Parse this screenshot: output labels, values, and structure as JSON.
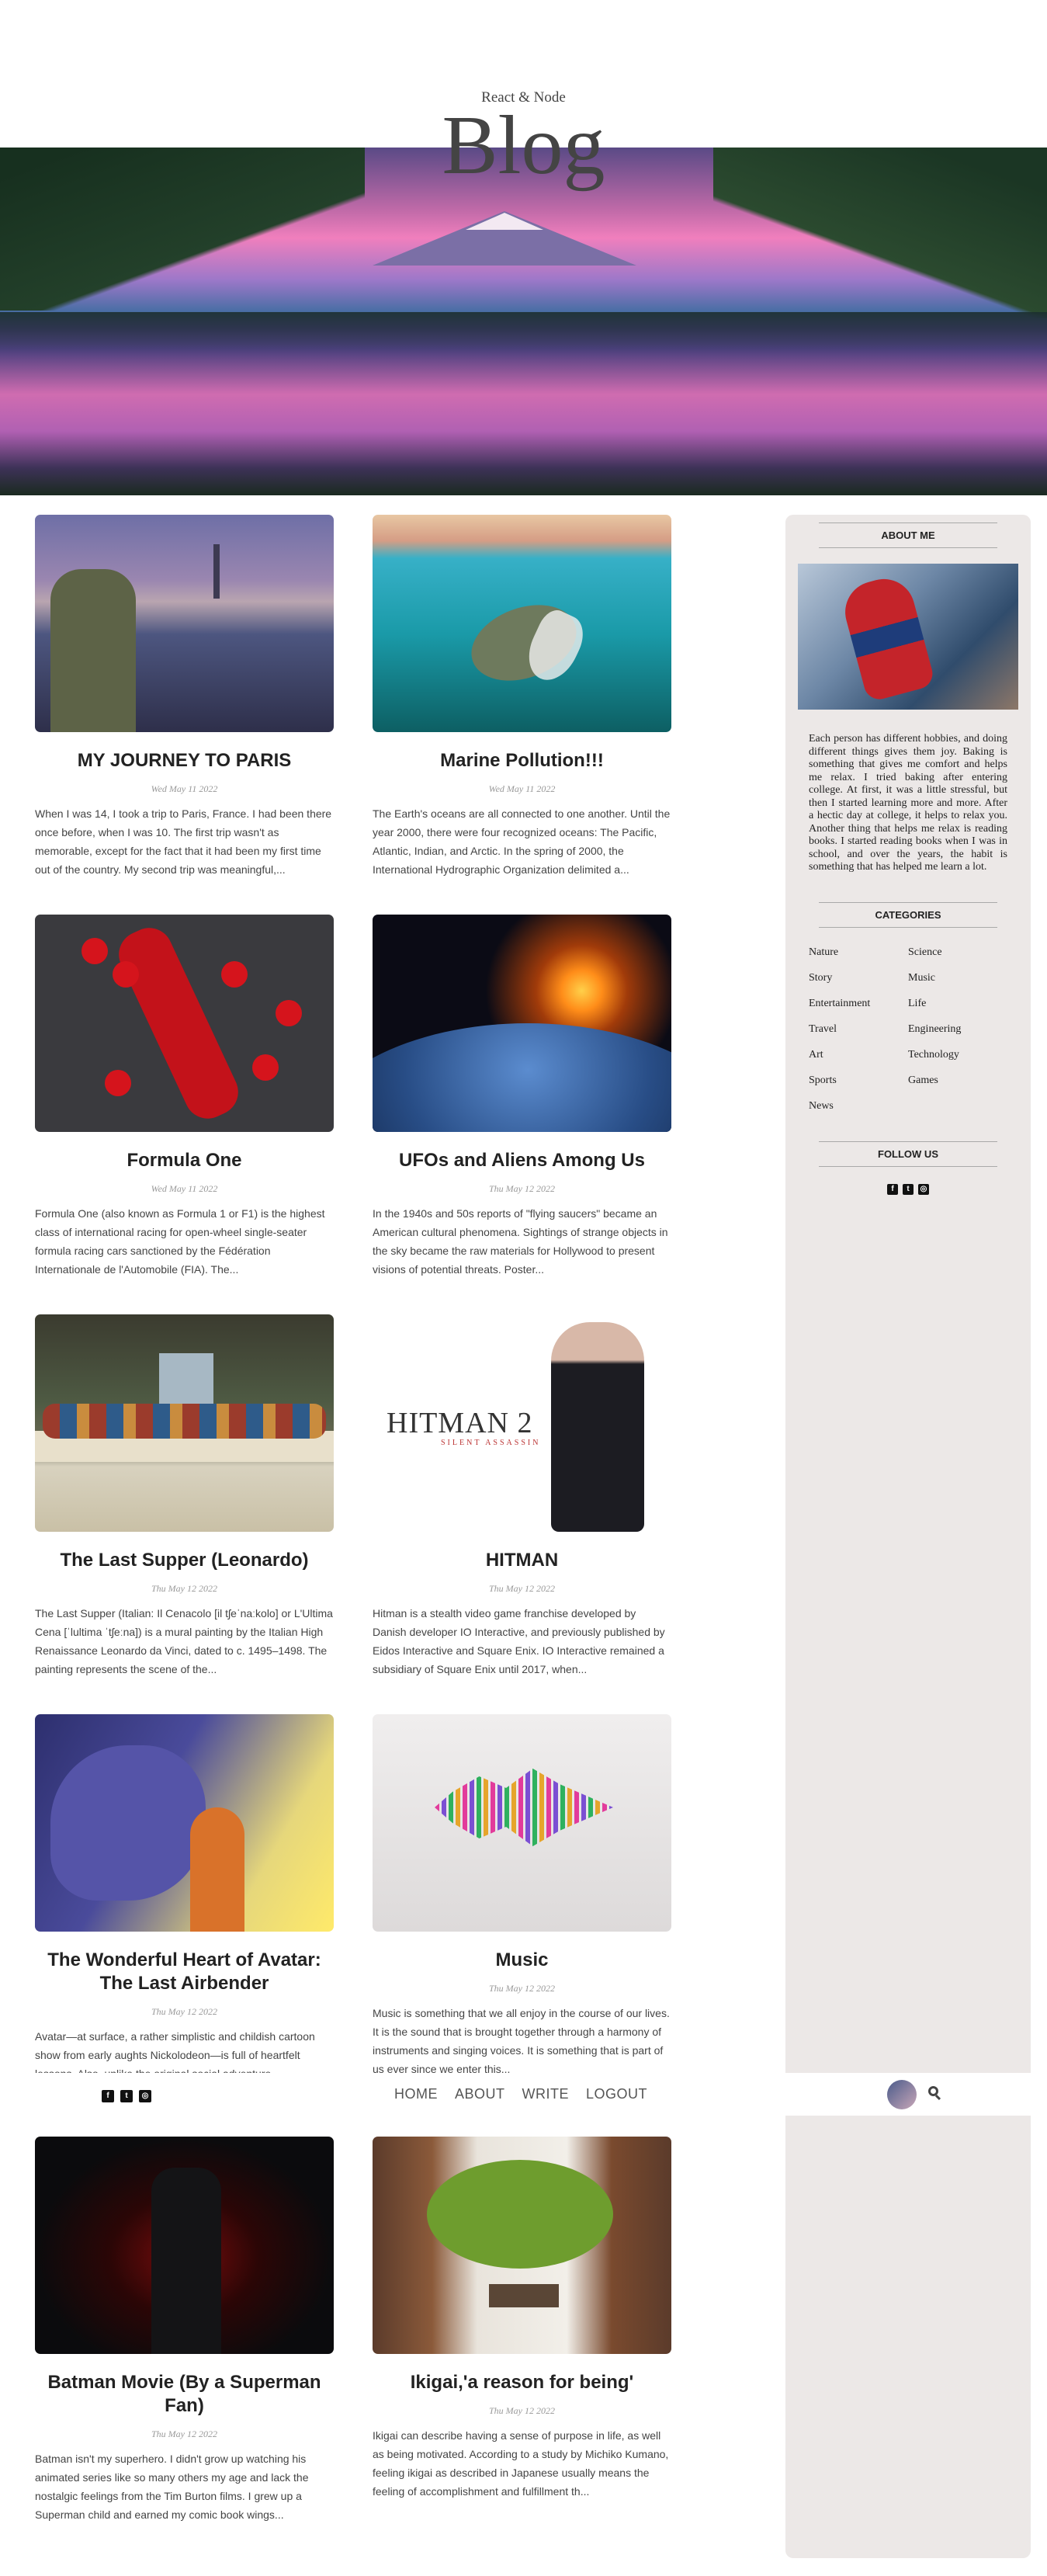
{
  "header": {
    "subtitle": "React & Node",
    "title": "Blog"
  },
  "nav": {
    "social": [
      "facebook-icon",
      "twitter-icon",
      "instagram-icon"
    ],
    "links": [
      "HOME",
      "ABOUT",
      "WRITE",
      "LOGOUT"
    ],
    "search_icon": "search-icon"
  },
  "posts": [
    {
      "title": "MY JOURNEY TO PARIS",
      "date": "Wed May 11 2022",
      "desc": "When I was 14, I took a trip to Paris, France. I had been there once before, when I was 10. The first trip wasn't as memorable, except for the fact that it had been my first time out of the country. My second trip was meaningful,..."
    },
    {
      "title": "Marine Pollution!!!",
      "date": "Wed May 11 2022",
      "desc": "The Earth's oceans are all connected to one another. Until the year 2000, there were four recognized oceans: The Pacific, Atlantic, Indian, and Arctic. In the spring of 2000, the International Hydrographic Organization delimited a..."
    },
    {
      "title": "Formula One",
      "date": "Wed May 11 2022",
      "desc": "Formula One (also known as Formula 1 or F1) is the highest class of international racing for open-wheel single-seater formula racing cars sanctioned by the Fédération Internationale de l'Automobile (FIA). The..."
    },
    {
      "title": "UFOs and Aliens Among Us",
      "date": "Thu May 12 2022",
      "desc": "In the 1940s and 50s reports of \"flying saucers\" became an American cultural phenomena. Sightings of strange objects in the sky became the raw materials for Hollywood to present visions of potential threats. Poster..."
    },
    {
      "title": "The Last Supper (Leonardo)",
      "date": "Thu May 12 2022",
      "desc": "The Last Supper (Italian: Il Cenacolo [il tʃeˈnaːkolo] or L'Ultima Cena [ˈlultima ˈtʃeːna]) is a mural painting by the Italian High Renaissance Leonardo da Vinci, dated to c. 1495–1498. The painting represents the scene of the..."
    },
    {
      "title": "HITMAN",
      "date": "Thu May 12 2022",
      "desc": "Hitman is a stealth video game franchise developed by Danish developer IO Interactive, and previously published by Eidos Interactive and Square Enix. IO Interactive remained a subsidiary of Square Enix until 2017, when..."
    },
    {
      "title": "The Wonderful Heart of Avatar: The Last Airbender",
      "date": "Thu May 12 2022",
      "desc": "Avatar—at surface, a rather simplistic and childish cartoon show from early aughts Nickolodeon—is full of heartfelt lessons. Also, unlike the original social adventure..."
    },
    {
      "title": "Music",
      "date": "Thu May 12 2022",
      "desc": "Music is something that we all enjoy in the course of our lives. It is the sound that is brought together through a harmony of instruments and singing voices. It is something that is part of us ever since we enter this..."
    },
    {
      "title": "Batman Movie (By a Superman Fan)",
      "date": "Thu May 12 2022",
      "desc": "Batman isn't my superhero. I didn't grow up watching his animated series like so many others my age and lack the nostalgic feelings from the Tim Burton films. I grew up a Superman child and earned my comic book wings..."
    },
    {
      "title": "Ikigai,'a reason for being'",
      "date": "Thu May 12 2022",
      "desc": "Ikigai can describe having a sense of purpose in life, as well as being motivated. According to a study by Michiko Kumano, feeling ikigai as described in Japanese usually means the feeling of accomplishment and fulfillment th..."
    }
  ],
  "sidebar": {
    "about_title": "ABOUT ME",
    "about_text": "Each person has different hobbies, and doing different things gives them joy. Baking is something that gives me comfort and helps me relax. I tried baking after entering college. At first, it was a little stressful, but then I started learning more and more. After a hectic day at college, it helps to relax you. Another thing that helps me relax is reading books. I started reading books when I was in school, and over the years, the habit is something that has helped me learn a lot.",
    "categories_title": "CATEGORIES",
    "categories": [
      "Nature",
      "Science",
      "Story",
      "Music",
      "Entertainment",
      "Life",
      "Travel",
      "Engineering",
      "Art",
      "Technology",
      "Sports",
      "Games",
      "News"
    ],
    "follow_title": "FOLLOW US",
    "social": [
      "facebook-icon",
      "twitter-icon",
      "instagram-icon"
    ]
  }
}
